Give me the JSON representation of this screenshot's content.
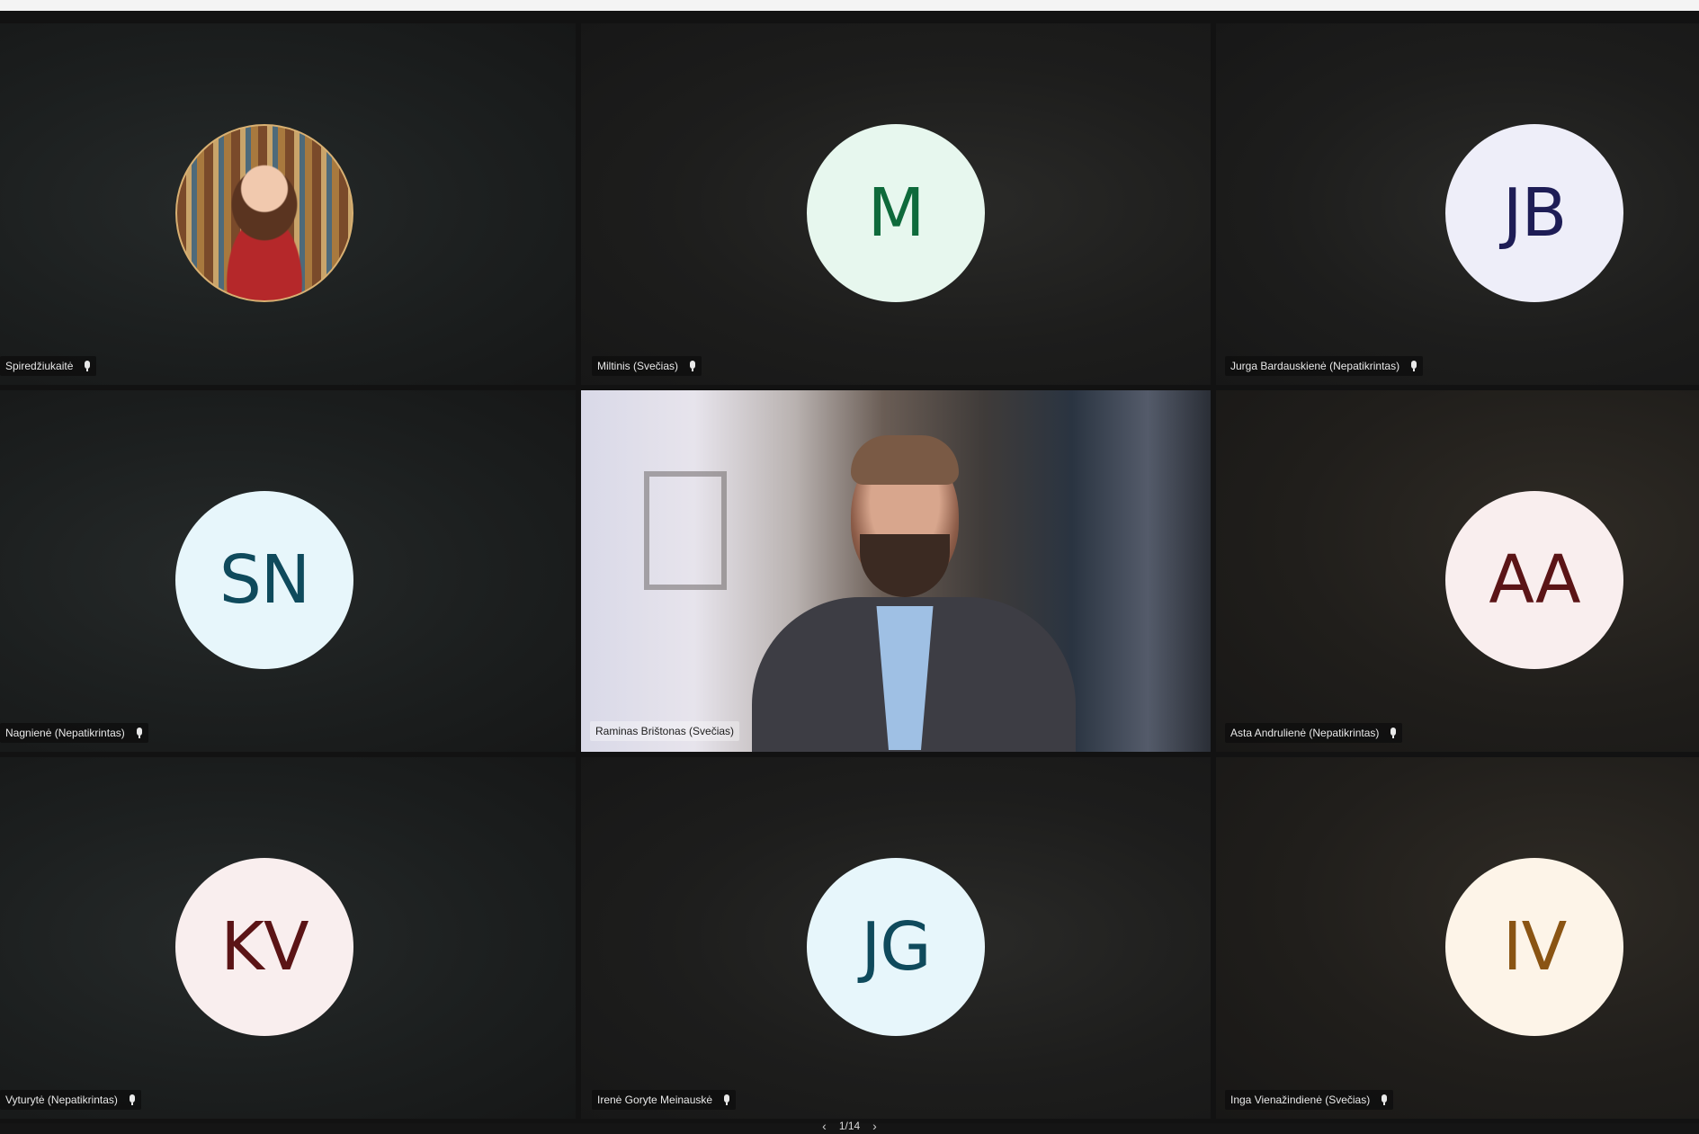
{
  "tiles": [
    {
      "name": "Spiredžiukaitė",
      "label_visible": "Spiredžiukaitė",
      "avatar": "photo",
      "initials": "",
      "circle_color": "#f0d3b0",
      "text_color": "#000000"
    },
    {
      "name": "Miltinis (Svečias)",
      "label_visible": "Miltinis (Svečias)",
      "avatar": "initials",
      "initials": "M",
      "circle_color": "#e7f7ee",
      "text_color": "#0e6a3b"
    },
    {
      "name": "Jurga Bardauskienė (Nepatikrintas)",
      "label_visible": "Jurga Bardauskienė (Nepatikrintas)",
      "avatar": "initials",
      "initials": "JB",
      "circle_color": "#eeeef9",
      "text_color": "#1e1d56"
    },
    {
      "name": "Nagnienė (Nepatikrintas)",
      "label_visible": "Nagnienė (Nepatikrintas)",
      "avatar": "initials",
      "initials": "SN",
      "circle_color": "#e7f6fb",
      "text_color": "#0f4a5c"
    },
    {
      "name": "Raminas Brištonas (Svečias)",
      "label_visible": "Raminas Brištonas (Svečias)",
      "avatar": "video",
      "initials": "",
      "circle_color": "",
      "text_color": ""
    },
    {
      "name": "Asta Andrulienė (Nepatikrintas)",
      "label_visible": "Asta Andrulienė (Nepatikrintas)",
      "avatar": "initials",
      "initials": "AA",
      "circle_color": "#f9eeee",
      "text_color": "#5b1416"
    },
    {
      "name": "Vyturytė (Nepatikrintas)",
      "label_visible": "Vyturytė (Nepatikrintas)",
      "avatar": "initials",
      "initials": "KV",
      "circle_color": "#f9eeee",
      "text_color": "#5b1416"
    },
    {
      "name": "Irenė Goryte Meinauskė",
      "label_visible": "Irenė Goryte Meinauskė",
      "avatar": "initials",
      "initials": "JG",
      "circle_color": "#e7f6fb",
      "text_color": "#0f4a5c"
    },
    {
      "name": "Inga Vienažindienė (Svečias)",
      "label_visible": "Inga Vienažindienė (Svečias)",
      "avatar": "initials",
      "initials": "IV",
      "circle_color": "#fdf4e8",
      "text_color": "#8a5413"
    }
  ],
  "pager": {
    "text": "1/14",
    "prev_icon": "chevron-left-icon",
    "next_icon": "chevron-right-icon"
  }
}
